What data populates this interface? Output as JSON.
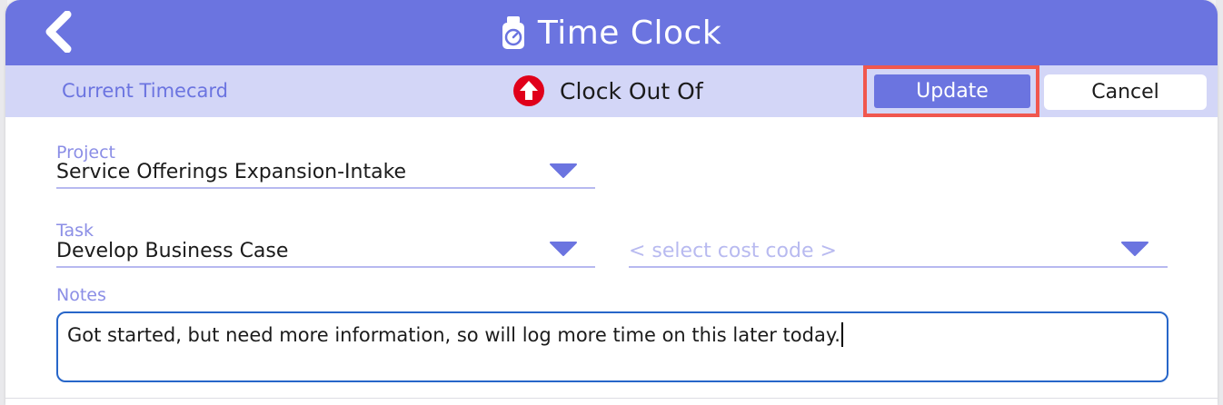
{
  "header": {
    "title": "Time Clock",
    "back_icon": "chevron-left-icon",
    "title_icon": "stopwatch-icon",
    "color": "#6b74e0"
  },
  "subheader": {
    "current_timecard_label": "Current Timecard",
    "clock_out_label": "Clock Out Of",
    "clock_out_icon": "arrow-up-circle-icon",
    "clock_out_icon_color": "#e0001a",
    "update_label": "Update",
    "cancel_label": "Cancel",
    "highlight_color": "#f0574e"
  },
  "form": {
    "project": {
      "label": "Project",
      "value": "Service Offerings Expansion-Intake"
    },
    "task": {
      "label": "Task",
      "value": "Develop Business Case"
    },
    "cost_code": {
      "placeholder": "< select cost code >"
    },
    "notes": {
      "label": "Notes",
      "value": "Got started, but need more information, so will log more time on this later today."
    }
  }
}
